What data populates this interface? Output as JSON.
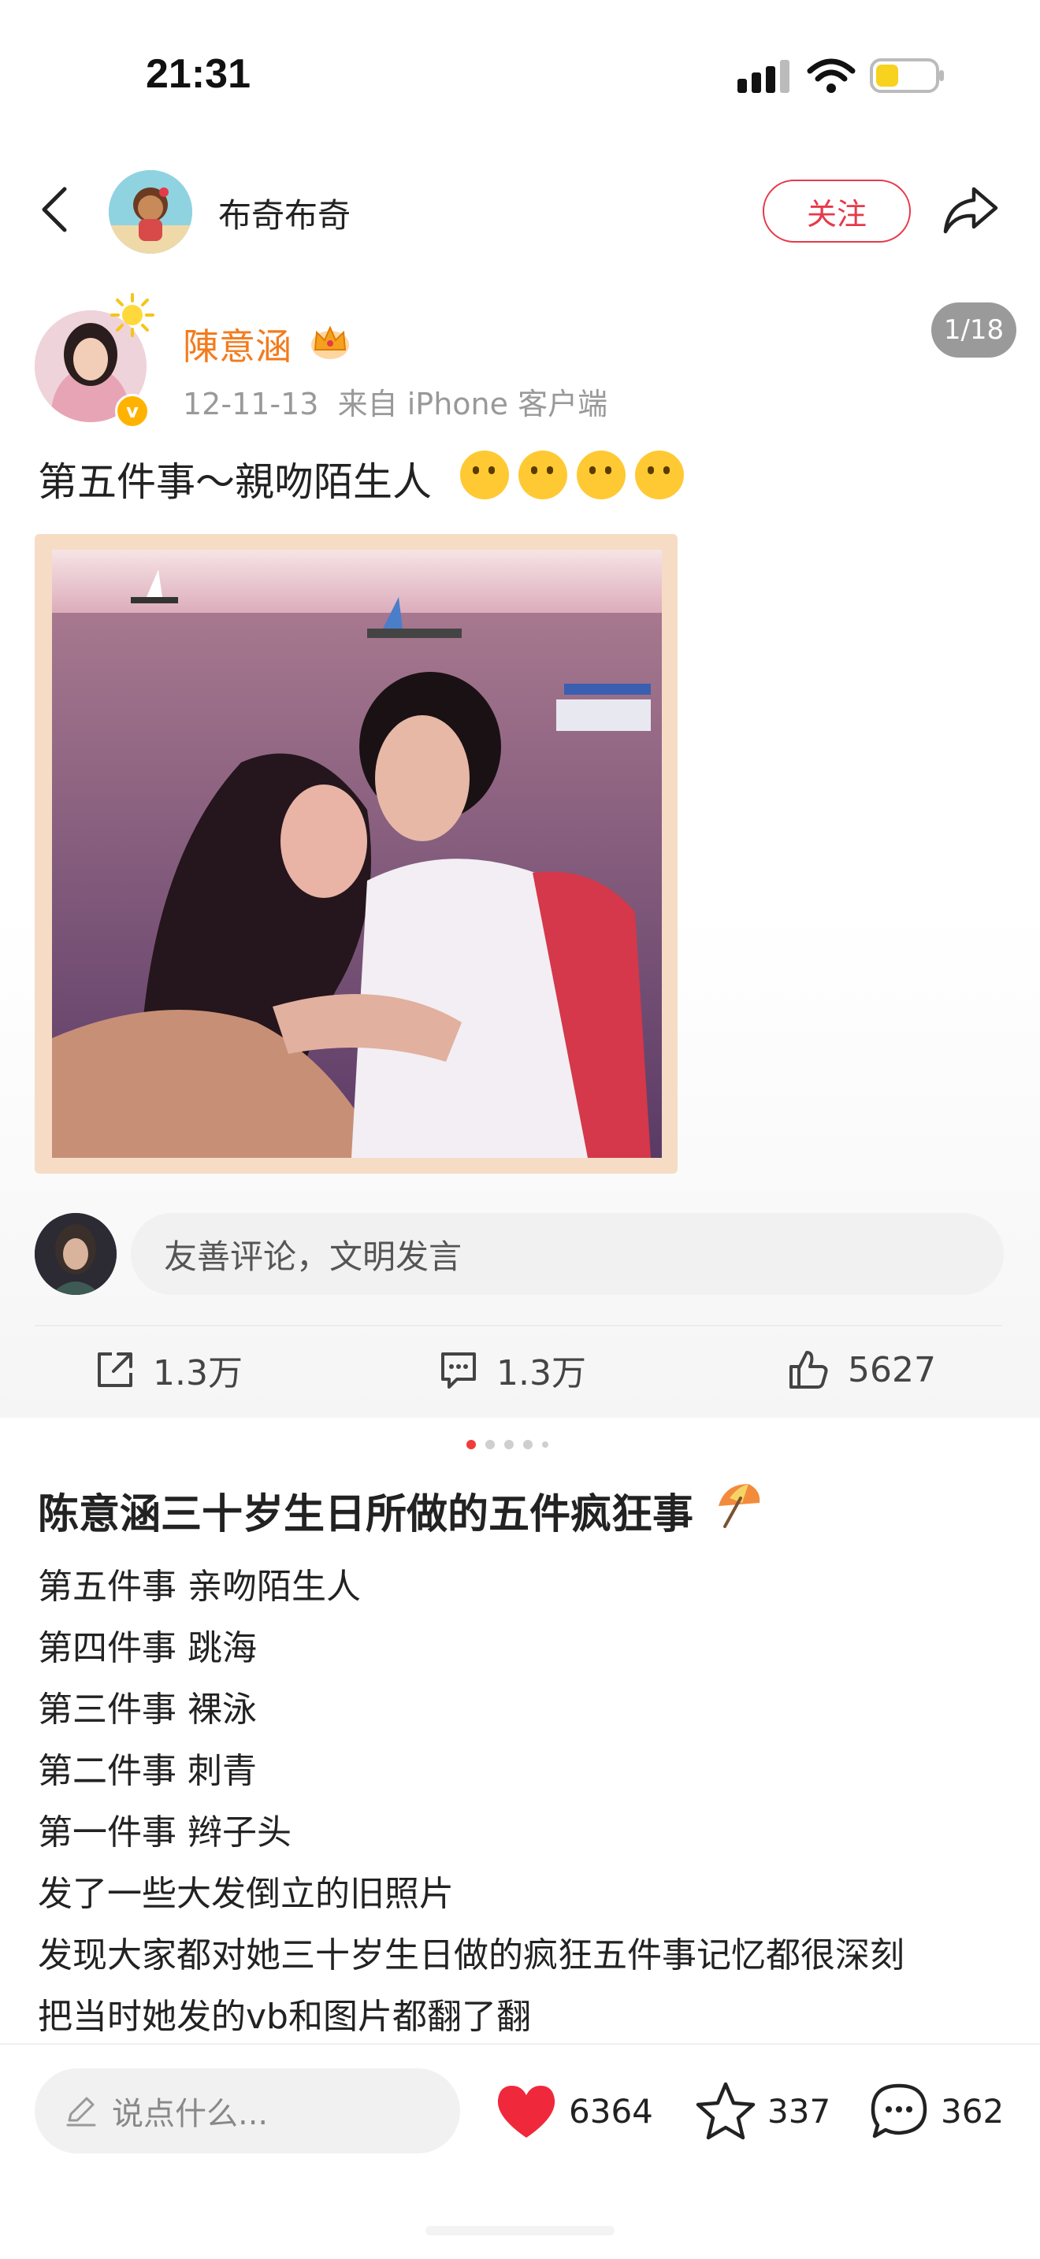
{
  "status_bar": {
    "time": "21:31"
  },
  "header": {
    "page_name": "布奇布奇",
    "follow_label": "关注"
  },
  "post": {
    "author": "陳意涵",
    "date": "12-11-13",
    "source": "来自 iPhone 客户端",
    "page_indicator": "1/18",
    "text": "第五件事～親吻陌生人",
    "emoji_count": 4
  },
  "comment_input": {
    "placeholder": "友善评论，文明发言"
  },
  "actions": {
    "repost": "1.3万",
    "comment": "1.3万",
    "like": "5627"
  },
  "carousel": {
    "total_dots": 5,
    "active_index": 0
  },
  "article": {
    "title": "陈意涵三十岁生日所做的五件疯狂事",
    "lines": [
      "第五件事 亲吻陌生人",
      "第四件事 跳海",
      "第三件事 裸泳",
      "第二件事 刺青",
      "第一件事 辫子头",
      "发了一些大发倒立的旧照片",
      "发现大家都对她三十岁生日做的疯狂五件事记忆都很深刻",
      "把当时她发的vb和图片都翻了翻"
    ]
  },
  "bottom_bar": {
    "input_placeholder": "说点什么...",
    "likes": "6364",
    "favorites": "337",
    "comments": "362"
  },
  "colors": {
    "accent_red": "#e6394a",
    "author_orange": "#f37b1d",
    "heart_red": "#f0283c"
  },
  "icons": [
    "back-icon",
    "share-icon",
    "crown-icon",
    "repost-icon",
    "comment-icon",
    "like-icon",
    "pencil-icon",
    "heart-icon",
    "star-icon",
    "chat-bubble-icon",
    "signal-icon",
    "wifi-icon",
    "battery-icon"
  ]
}
